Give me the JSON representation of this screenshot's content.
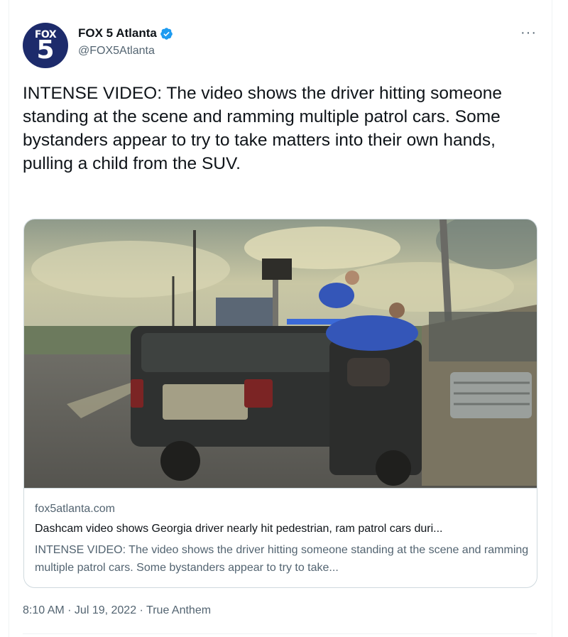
{
  "account": {
    "display_name": "FOX 5 Atlanta",
    "handle": "@FOX5Atlanta",
    "verified": true,
    "avatar_text_top": "FOX",
    "avatar_text_number": "5",
    "avatar_color": "#1d2b6b",
    "verified_icon": "verified-badge-icon",
    "verified_color": "#1d9bf0"
  },
  "tweet": {
    "text": "INTENSE VIDEO: The video shows the driver hitting someone standing at the scene and ramming multiple patrol cars. Some bystanders appear to try to take matters into their own hands, pulling a child from the SUV.",
    "more_icon": "more-options-icon",
    "more_label": "···"
  },
  "card": {
    "image_alt": "Dashcam still of men pulling a child from an SUV beside a police patrol car",
    "domain": "fox5atlanta.com",
    "title": "Dashcam video shows Georgia driver nearly hit pedestrian, ram patrol cars duri...",
    "description": "INTENSE VIDEO: The video shows the driver hitting someone standing at the scene and ramming multiple patrol cars. Some bystanders appear to try to take..."
  },
  "meta": {
    "time": "8:10 AM",
    "sep1": " · ",
    "date": "Jul 19, 2022",
    "sep2": " · ",
    "source": "True Anthem"
  },
  "colors": {
    "text_primary": "#0f1419",
    "text_secondary": "#536471",
    "border": "#cfd9de"
  }
}
